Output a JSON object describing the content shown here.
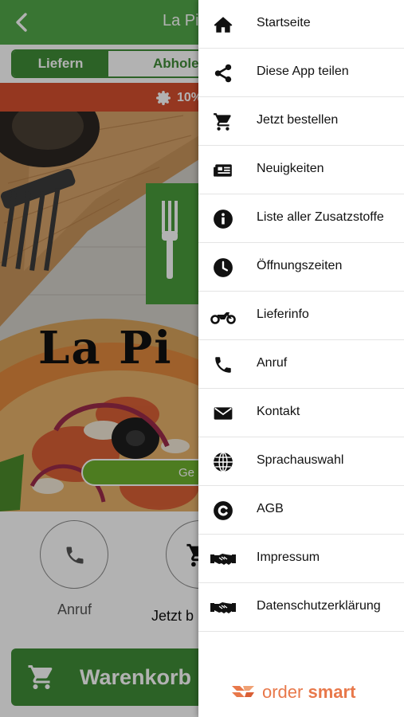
{
  "background": {
    "title": "La Pi",
    "order_mode_tabs": [
      "Liefern",
      "Abholen"
    ],
    "active_order_mode": "Liefern",
    "promo_text": "10%",
    "hero_logo_text": "La Pi",
    "hero_badge_text": "Ge",
    "call_label": "Anruf",
    "order_label": "Jetzt b",
    "cart_label": "Warenkorb"
  },
  "drawer": {
    "items": [
      {
        "label": "Startseite",
        "icon": "home-icon"
      },
      {
        "label": "Diese App teilen",
        "icon": "share-icon"
      },
      {
        "label": "Jetzt bestellen",
        "icon": "cart-icon"
      },
      {
        "label": "Neuigkeiten",
        "icon": "newspaper-icon"
      },
      {
        "label": "Liste aller Zusatzstoffe",
        "icon": "info-icon"
      },
      {
        "label": "Öffnungszeiten",
        "icon": "clock-icon"
      },
      {
        "label": "Lieferinfo",
        "icon": "motorcycle-icon"
      },
      {
        "label": "Anruf",
        "icon": "phone-icon"
      },
      {
        "label": "Kontakt",
        "icon": "envelope-icon"
      },
      {
        "label": "Sprachauswahl",
        "icon": "globe-icon"
      },
      {
        "label": "AGB",
        "icon": "copyright-icon"
      },
      {
        "label": "Impressum",
        "icon": "handshake-icon"
      },
      {
        "label": "Datenschutzerklärung",
        "icon": "handshake-icon"
      }
    ],
    "brand": {
      "part1": "order",
      "part2": "smart"
    }
  },
  "colors": {
    "brand_green": "#52a84a",
    "dark_green": "#3f8d37",
    "promo_red": "#d6502f",
    "brand_orange": "#e8784a"
  }
}
